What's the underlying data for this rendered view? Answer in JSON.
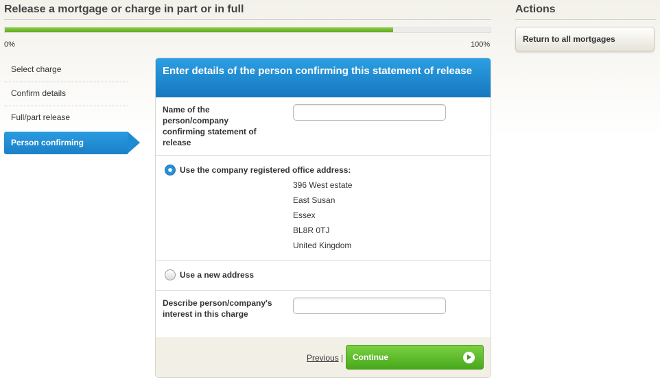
{
  "page": {
    "title": "Release a mortgage or charge in part or in full"
  },
  "progress": {
    "start_label": "0%",
    "end_label": "100%",
    "fraction": 0.8
  },
  "steps": [
    {
      "label": "Select charge",
      "active": false
    },
    {
      "label": "Confirm details",
      "active": false
    },
    {
      "label": "Full/part release",
      "active": false
    },
    {
      "label": "Person confirming",
      "active": true
    }
  ],
  "form": {
    "header": "Enter details of the person confirming this statement of release",
    "name_label": "Name of the person/company confirming statement of release",
    "name_value": "",
    "registered_option_label": "Use the company registered office address:",
    "registered_selected": true,
    "address_lines": [
      "396 West estate",
      "East Susan",
      "Essex",
      "BL8R 0TJ",
      "United Kingdom"
    ],
    "new_address_label": "Use a new address",
    "new_address_selected": false,
    "interest_label": "Describe person/company's interest in this charge",
    "interest_value": ""
  },
  "footer": {
    "previous_label": "Previous",
    "separator": "|",
    "continue_label": "Continue"
  },
  "actions": {
    "title": "Actions",
    "return_label": "Return to all mortgages"
  },
  "icons": {
    "continue": "play-arrow-icon",
    "radio_checked": "radio-checked-icon",
    "radio_unchecked": "radio-unchecked-icon"
  },
  "colors": {
    "progress_fill": "#62a923",
    "active_step": "#1f8bd2",
    "header_blue": "#1677c0",
    "continue_green": "#47a81c"
  }
}
